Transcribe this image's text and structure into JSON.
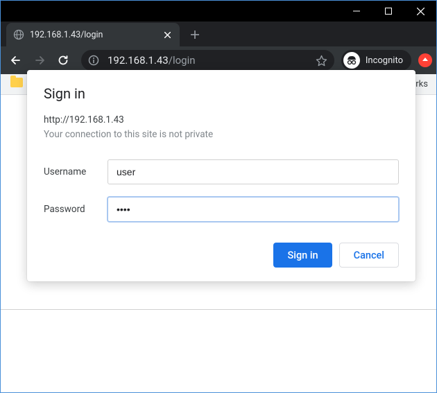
{
  "window": {
    "minimize": "min",
    "maximize": "max",
    "close": "close"
  },
  "tab": {
    "title": "192.168.1.43/login"
  },
  "toolbar": {
    "url_host": "192.168.1.43",
    "url_path": "/login",
    "incognito_label": "Incognito"
  },
  "bookmarks": {
    "other_label": "rks"
  },
  "dialog": {
    "title": "Sign in",
    "origin": "http://192.168.1.43",
    "warning": "Your connection to this site is not private",
    "username_label": "Username",
    "username_value": "user",
    "password_label": "Password",
    "password_value": "••••",
    "signin_label": "Sign in",
    "cancel_label": "Cancel"
  }
}
